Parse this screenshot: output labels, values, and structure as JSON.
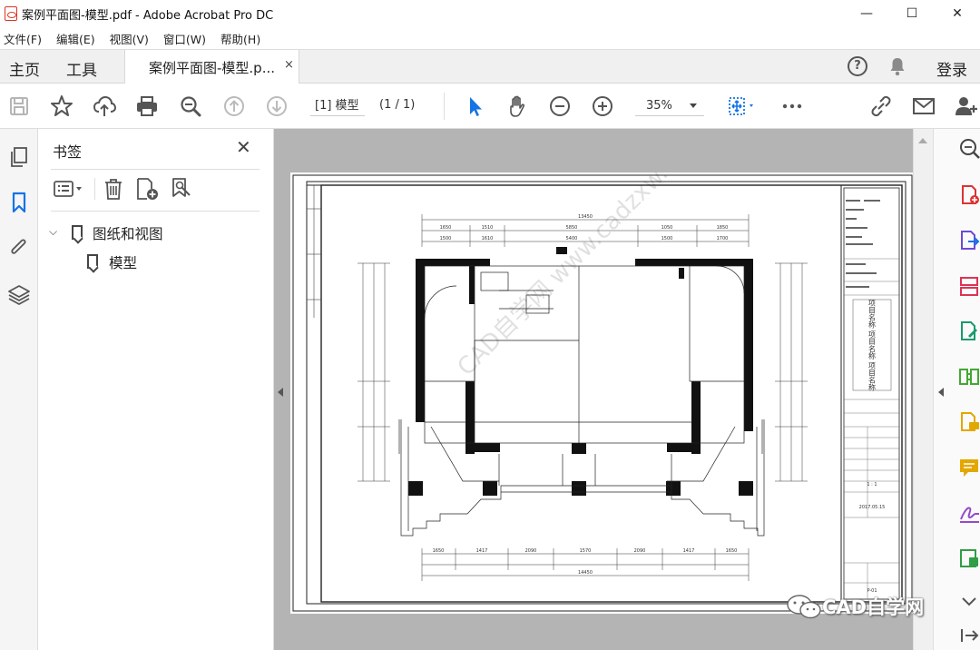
{
  "window": {
    "title": "案例平面图-模型.pdf - Adobe Acrobat Pro DC",
    "minimize": "—",
    "maximize": "☐",
    "close": "✕"
  },
  "menu": [
    "文件(F)",
    "编辑(E)",
    "视图(V)",
    "窗口(W)",
    "帮助(H)"
  ],
  "tabs": {
    "home": "主页",
    "tools": "工具",
    "document": "案例平面图-模型.p...",
    "close": "×"
  },
  "header_right": {
    "help": "?",
    "login": "登录"
  },
  "toolbar": {
    "page_field": "[1] 模型",
    "page_count": "(1 / 1)",
    "zoom": "35%"
  },
  "bookmarks": {
    "title": "书签",
    "close": "✕",
    "tree": [
      {
        "label": "图纸和视图",
        "expanded": true,
        "children": [
          {
            "label": "模型"
          }
        ]
      }
    ]
  },
  "drawing": {
    "dim_top_total": "13450",
    "dim_top_row": [
      "1650",
      "1510",
      "5850",
      "1050",
      "1850"
    ],
    "dim_top_row2": [
      "1500",
      "1610",
      "5400",
      "1500",
      "1700"
    ],
    "dim_bottom_row": [
      "1650",
      "1417",
      "2090",
      "1570",
      "2090",
      "1417",
      "1650"
    ],
    "dim_bottom_total": "14450",
    "watermark_diag": "CAD自学网 www.cadzxw.com"
  },
  "titleblock": {
    "project_title": "项目名称 项目名称 项目名称",
    "scale": "1 : 1",
    "date": "2017.05.15",
    "sheet": "P-01"
  },
  "wechat_watermark": "CAD自学网",
  "colors": {
    "accent": "#1473e6",
    "pdf_red": "#dd3333",
    "canvas_gray": "#b4b4b4"
  }
}
